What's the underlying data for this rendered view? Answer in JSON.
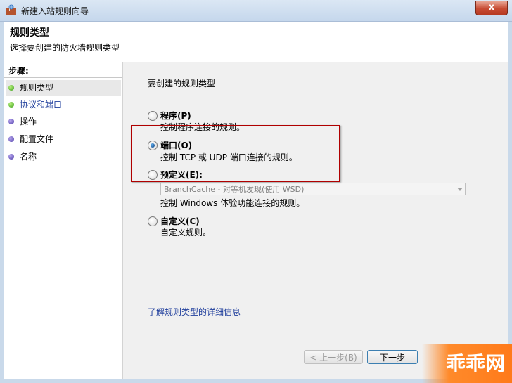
{
  "window": {
    "title": "新建入站规则向导",
    "close_glyph": "x"
  },
  "header": {
    "title": "规则类型",
    "subtitle": "选择要创建的防火墙规则类型"
  },
  "steps": {
    "heading": "步骤:",
    "items": [
      {
        "label": "规则类型",
        "status": "current"
      },
      {
        "label": "协议和端口",
        "status": "link"
      },
      {
        "label": "操作",
        "status": "pending"
      },
      {
        "label": "配置文件",
        "status": "pending"
      },
      {
        "label": "名称",
        "status": "pending"
      }
    ]
  },
  "pane": {
    "prompt": "要创建的规则类型",
    "options": [
      {
        "label": "程序(P)",
        "desc": "控制程序连接的规则。",
        "checked": false
      },
      {
        "label": "端口(O)",
        "desc": "控制 TCP 或 UDP 端口连接的规则。",
        "checked": true
      },
      {
        "label": "预定义(E):",
        "desc": "控制 Windows 体验功能连接的规则。",
        "checked": false
      },
      {
        "label": "自定义(C)",
        "desc": "自定义规则。",
        "checked": false
      }
    ],
    "predefined_select_value": "BranchCache - 对等机发现(使用 WSD)",
    "info_link": "了解规则类型的详细信息"
  },
  "buttons": {
    "back": "< 上一步(B)",
    "next": "下一步"
  },
  "watermark": {
    "text": "乖乖网"
  },
  "colors": {
    "highlight_border": "#b00000",
    "link": "#1f3e9c",
    "watermark": "#ff7a1a"
  }
}
